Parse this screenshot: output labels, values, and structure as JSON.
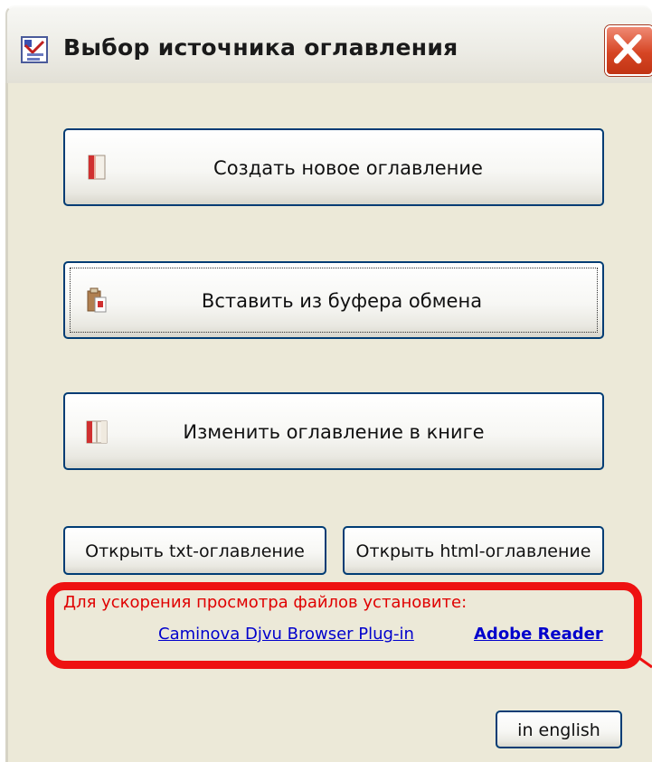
{
  "window": {
    "title": "Выбор источника оглавления"
  },
  "buttons": {
    "create": "Создать новое оглавление",
    "paste": "Вставить из буфера обмена",
    "edit": "Изменить оглавление в книге",
    "open_txt": "Открыть txt-оглавление",
    "open_html": "Открыть html-оглавление",
    "english": "in english"
  },
  "notice": {
    "text": "Для ускорения просмотра файлов установите:",
    "links": {
      "caminova": "Caminova Djvu Browser Plug-in",
      "adobe": "Adobe Reader"
    }
  },
  "icons": {
    "title": "toc-book-icon",
    "close": "close-icon",
    "create": "new-document-icon",
    "paste": "clipboard-paste-icon",
    "edit": "open-book-icon"
  },
  "colors": {
    "close_red": "#d64524",
    "notice_red": "#e00000",
    "link_blue": "#0000cc",
    "highlight_red": "#ee1111",
    "button_border": "#003c74",
    "dialog_bg": "#ece9d8"
  }
}
